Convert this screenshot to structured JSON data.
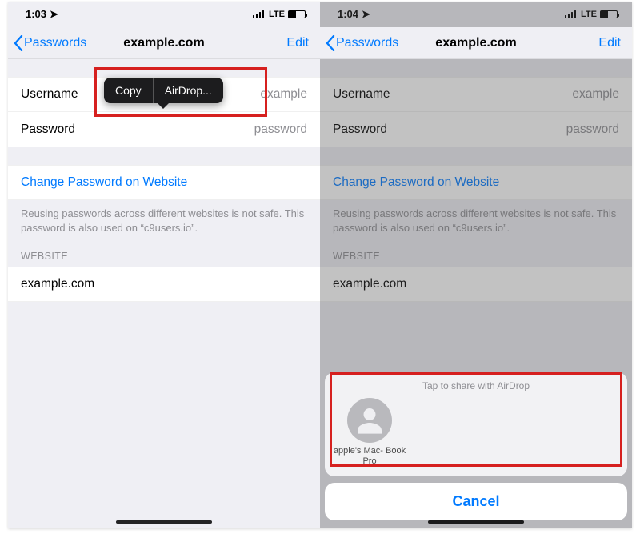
{
  "colors": {
    "tint": "#007aff",
    "highlight": "#d6201f"
  },
  "left": {
    "status": {
      "time": "1:03",
      "carrier": "LTE"
    },
    "nav": {
      "back": "Passwords",
      "title": "example.com",
      "edit": "Edit"
    },
    "rows": {
      "username_label": "Username",
      "username_value": "example",
      "password_label": "Password",
      "password_value": "password",
      "change_link": "Change Password on Website",
      "note": "Reusing passwords across different websites is not safe. This password is also used on “c9users.io”.",
      "section": "WEBSITE",
      "website": "example.com"
    },
    "menu": {
      "copy": "Copy",
      "airdrop": "AirDrop..."
    }
  },
  "right": {
    "status": {
      "time": "1:04",
      "carrier": "LTE"
    },
    "nav": {
      "back": "Passwords",
      "title": "example.com",
      "edit": "Edit"
    },
    "rows": {
      "username_label": "Username",
      "username_value": "example",
      "password_label": "Password",
      "password_value": "password",
      "change_link": "Change Password on Website",
      "note": "Reusing passwords across different websites is not safe. This password is also used on “c9users.io”.",
      "section": "WEBSITE",
      "website": "example.com"
    },
    "sheet": {
      "hint": "Tap to share with AirDrop",
      "contact_name": "apple's Mac-\nBook Pro",
      "cancel": "Cancel"
    }
  }
}
